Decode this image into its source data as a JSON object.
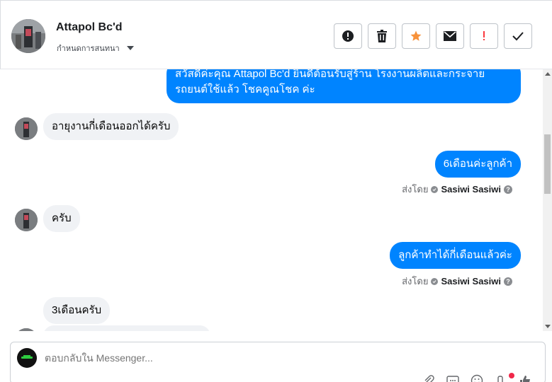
{
  "header": {
    "contact_name": "Attapol Bc'd",
    "assign_label": "กำหนดการสนทนา"
  },
  "toolbar": {
    "buttons": [
      {
        "name": "report-button",
        "icon": "alert-circle-icon"
      },
      {
        "name": "delete-button",
        "icon": "trash-icon"
      },
      {
        "name": "star-button",
        "icon": "star-icon",
        "color": "#f7923b"
      },
      {
        "name": "mark-unread-button",
        "icon": "envelope-icon"
      },
      {
        "name": "mark-important-button",
        "icon": "exclamation-icon",
        "color": "#fa383e"
      },
      {
        "name": "done-button",
        "icon": "check-icon"
      }
    ]
  },
  "messages": {
    "welcome": "สวัสดีค่ะคุณ Attapol Bc'd ยินดีต้อนรับสู่ร้าน โรงงานผลิตและกระจาย รถยนต์ใช้แล้ว โชคคูณโชค ค่ะ",
    "in_1": "อายุงานกี่เดือนออกได้ครับ",
    "out_1": "6เดือนค่ะลูกค้า",
    "in_2": "ครับ",
    "out_2": "ลูกค้าทำได้กี่เดือนแล้วค่ะ",
    "in_3": "3เดือนครับ",
    "sent_by_label": "ส่งโดย",
    "sender_name": "Sasiwi Sasiwi"
  },
  "composer": {
    "placeholder": "ตอบกลับใน Messenger..."
  },
  "colors": {
    "outgoing_bubble": "#0084ff",
    "incoming_bubble": "#f0f2f5"
  }
}
